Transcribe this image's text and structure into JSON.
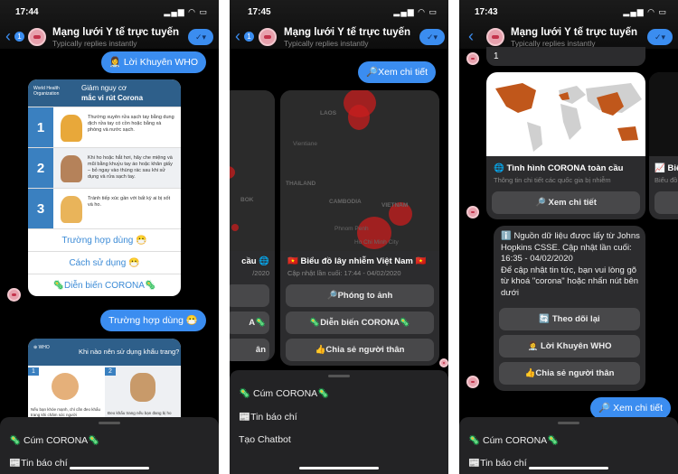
{
  "app": {
    "title": "Mạng lưới Y tế trực tuyến",
    "subtitle": "Typically replies instantly",
    "unread_badge": "1",
    "accent": "#3b8df0"
  },
  "phone1": {
    "time": "17:44",
    "user_msg_1": "👩‍⚕️ Lời Khuyên WHO",
    "who_card": {
      "org": "World Health Organization",
      "title_line1": "Giảm nguy cơ",
      "title_line2": "mắc vi rút Corona",
      "steps": [
        {
          "n": "1",
          "text": "Thường xuyên rửa sạch tay bằng dung dịch rửa tay có cồn hoặc bằng xà phòng và nước sạch."
        },
        {
          "n": "2",
          "text": "Khi ho hoặc hắt hơi, hãy che miệng và mũi bằng khuỷu tay áo hoặc khăn giấy – bỏ ngay vào thùng rác sau khi sử dụng và rửa sạch tay."
        },
        {
          "n": "3",
          "text": "Tránh tiếp xúc gần với bất kỳ ai bị sốt và ho."
        }
      ],
      "quick_replies": [
        "Trường hợp dùng 😷",
        "Cách sử dụng 😷",
        "🦠Diễn biến CORONA🦠"
      ]
    },
    "user_msg_2": "Trường hợp dùng 😷",
    "mask_card": {
      "title": "Khi nào nên sử dụng khẩu trang?",
      "panels": [
        {
          "n": "1",
          "text": "Nếu bạn khỏe mạnh, chỉ cần đeo khẩu trang khi chăm sóc người"
        },
        {
          "n": "2",
          "text": "Đeo khẩu trang nếu bạn đang bị ho"
        }
      ]
    },
    "menu": [
      "🦠 Cúm CORONA🦠",
      "📰Tin báo chí"
    ]
  },
  "phone2": {
    "time": "17:45",
    "user_msg": "🔎Xem chi tiết",
    "map_labels": [
      "LAOS",
      "Vientiane",
      "THAILAND",
      "CAMBODIA",
      "VIETNAM",
      "Phnom Penh",
      "Ho Chi Minh City",
      "BOK"
    ],
    "left_card": {
      "title": "cầu 🌐",
      "subtitle": "/2020",
      "buttons": [
        "",
        "A🦠",
        "ân"
      ]
    },
    "card": {
      "title": "🇻🇳 Biểu đồ lây nhiễm Việt Nam 🇻🇳",
      "subtitle": "Cập nhật lần cuối: 17:44 - 04/02/2020",
      "buttons": [
        "🔎Phóng to ảnh",
        "🦠Diễn biến CORONA🦠",
        "👍Chia sẻ người thân"
      ]
    },
    "menu": [
      "🦠 Cúm CORONA🦠",
      "📰Tin báo chí",
      "Tạo Chatbot"
    ]
  },
  "phone3": {
    "time": "17:43",
    "prev_msg": "1",
    "card": {
      "title": "🌐 Tình hình CORONA toàn cầu",
      "subtitle": "Thông tin chi tiết các quốc gia bị nhiễm",
      "button": "🔎 Xem chi tiết",
      "map_highlight": "#c0571b"
    },
    "next_card": {
      "title": "📈 Biể",
      "subtitle": "Biểu đồ"
    },
    "info": {
      "text": "ℹ️ Nguồn dữ liệu được lấy từ Johns Hopkins CSSE. Cập nhật lần cuối: 16:35 - 04/02/2020\nĐể cập nhật tin tức, bạn vui lòng gõ từ khoá \"corona\" hoặc nhấn nút bên dưới",
      "buttons": [
        "🔄 Theo dõi lại",
        "👩‍⚕️ Lời Khuyên WHO",
        "👍Chia sẻ người thân"
      ]
    },
    "user_msg": "🔎 Xem chi tiết",
    "menu": [
      "🦠 Cúm CORONA🦠",
      "📰Tin báo chí"
    ]
  }
}
